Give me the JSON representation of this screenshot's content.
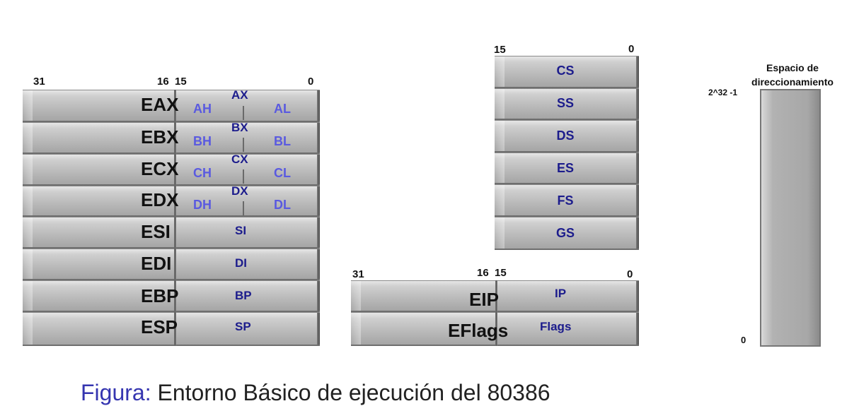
{
  "gp_block": {
    "bit_labels": {
      "b31": "31",
      "b16": "16",
      "b15": "15",
      "b0": "0"
    },
    "registers": [
      {
        "name": "EAX",
        "r16": "AX",
        "hi": "AH",
        "lo": "AL"
      },
      {
        "name": "EBX",
        "r16": "BX",
        "hi": "BH",
        "lo": "BL"
      },
      {
        "name": "ECX",
        "r16": "CX",
        "hi": "CH",
        "lo": "CL"
      },
      {
        "name": "EDX",
        "r16": "DX",
        "hi": "DH",
        "lo": "DL"
      },
      {
        "name": "ESI",
        "r16": "SI"
      },
      {
        "name": "EDI",
        "r16": "DI"
      },
      {
        "name": "EBP",
        "r16": "BP"
      },
      {
        "name": "ESP",
        "r16": "SP"
      }
    ]
  },
  "segment_block": {
    "bit_labels": {
      "b15": "15",
      "b0": "0"
    },
    "registers": [
      "CS",
      "SS",
      "DS",
      "ES",
      "FS",
      "GS"
    ]
  },
  "ip_block": {
    "bit_labels": {
      "b31": "31",
      "b16": "16",
      "b15": "15",
      "b0": "0"
    },
    "rows": [
      {
        "name": "EIP",
        "r16": "IP"
      },
      {
        "name": "EFlags",
        "r16": "Flags"
      }
    ]
  },
  "address_space": {
    "title_line1": "Espacio de",
    "title_line2": "direccionamiento",
    "top_label": "2^32 -1",
    "bottom_label": "0"
  },
  "caption": {
    "label": "Figura:",
    "text": "Entorno Básico de ejecución del 80386"
  },
  "colors": {
    "register_16bit": "#1c1c8c",
    "register_8bit": "#5a5ae0",
    "caption_label": "#3535b0"
  }
}
